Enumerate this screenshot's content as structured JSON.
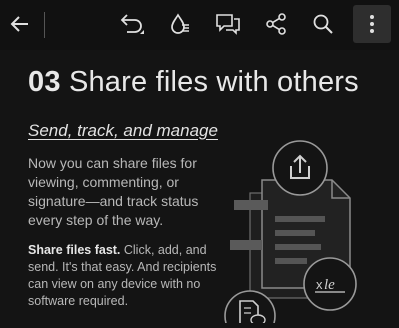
{
  "toolbar": {
    "icons": [
      "back-arrow-icon",
      "undo-icon",
      "ink-icon",
      "comment-icon",
      "share-icon",
      "search-icon",
      "more-vertical-icon"
    ]
  },
  "page": {
    "title_number": "03",
    "title_text": "Share files with others",
    "subtitle": "Send, track, and manage",
    "body1": "Now you can share files for viewing, commenting, or signature—and track status every step of the way.",
    "body2_bold": "Share files fast.",
    "body2_rest": " Click, add, and send. It's that easy. And recipients can view on any device with no software required.",
    "signature_mark": "x",
    "signature_glyph": "le"
  },
  "colors": {
    "background": "#000000",
    "page": "#141414",
    "illustration": "#8a8a8a"
  }
}
